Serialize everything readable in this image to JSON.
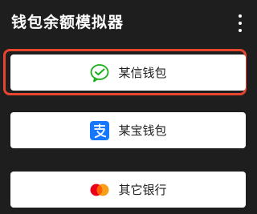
{
  "header": {
    "title": "钱包余额模拟器",
    "menu_icon": "more-vert-icon"
  },
  "wallets": [
    {
      "label": "某信钱包",
      "icon": "wechat-pay-icon",
      "icon_color": "#1aad19",
      "selected": true
    },
    {
      "label": "某宝钱包",
      "icon": "alipay-icon",
      "icon_color": "#1677ff"
    },
    {
      "label": "其它银行",
      "icon": "mastercard-icon",
      "icon_colors": [
        "#eb001b",
        "#f79e1b"
      ]
    }
  ],
  "colors": {
    "background": "#1e1e1e",
    "selection_border": "#e8452f",
    "button_bg": "#ffffff"
  }
}
